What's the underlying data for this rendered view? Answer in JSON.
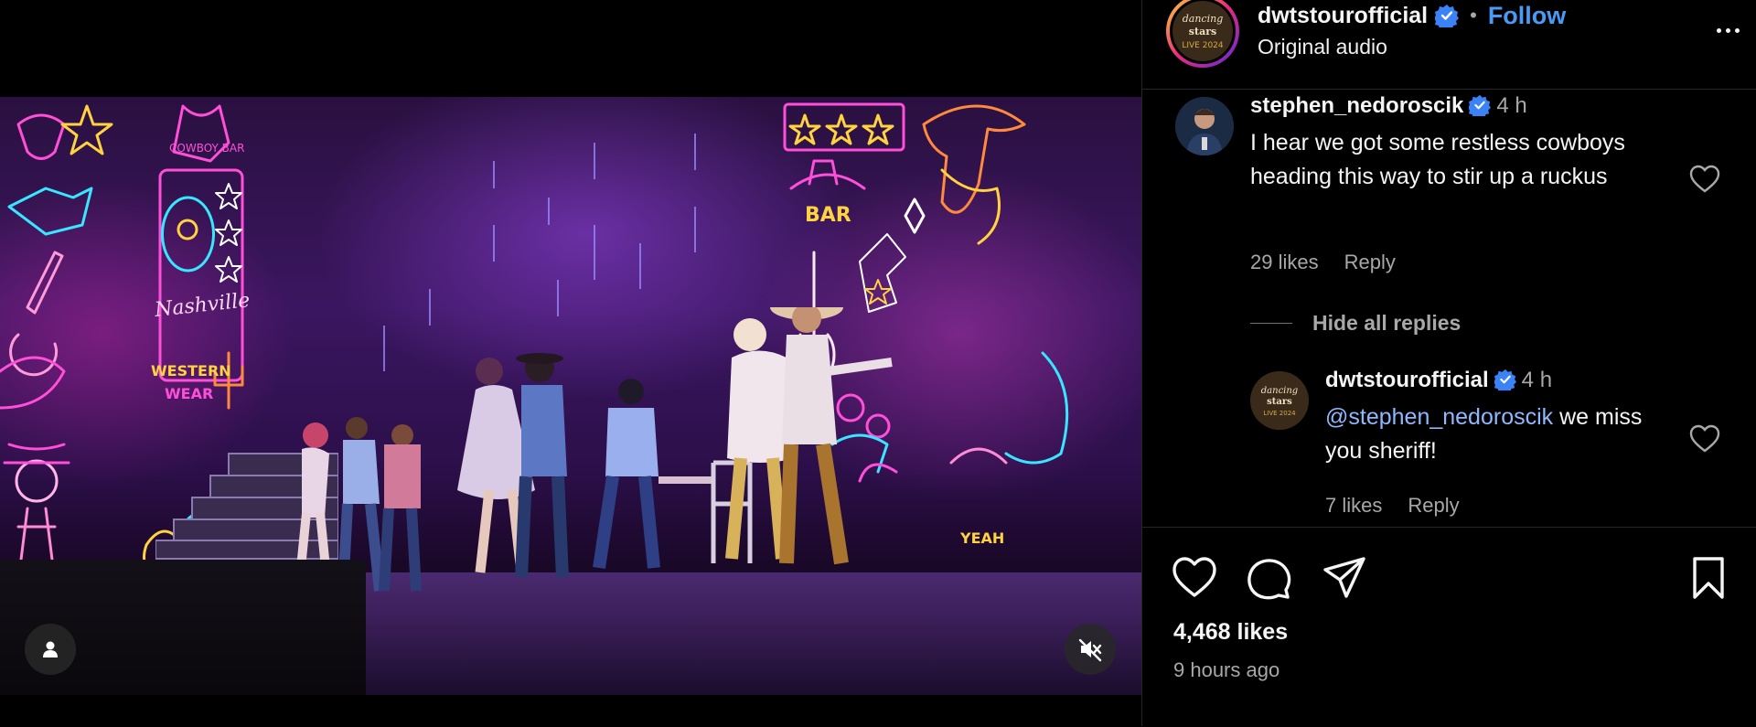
{
  "post": {
    "username": "dwtstourofficial",
    "follow_label": "Follow",
    "separator": "•",
    "audio_label": "Original audio",
    "avatar_text": [
      "dancing",
      "stars",
      "LIVE 2024"
    ]
  },
  "comments": [
    {
      "username": "stephen_nedoroscik",
      "time": "4 h",
      "text": "I hear we got some restless cowboys heading this way to stir up a ruckus",
      "likes": "29 likes",
      "reply_label": "Reply"
    }
  ],
  "hide_replies_label": "Hide all replies",
  "replies": [
    {
      "username": "dwtstourofficial",
      "time": "4 h",
      "mention": "@stephen_nedoroscik",
      "text": " we miss you sheriff!",
      "likes": "7 likes",
      "reply_label": "Reply"
    }
  ],
  "stats": {
    "likes": "4,468 likes",
    "posted": "9 hours ago"
  },
  "video": {
    "sign_texts": [
      "COWBOY BAR",
      "Nashville",
      "WESTERN WEAR",
      "BAR",
      "YEAH"
    ]
  },
  "colors": {
    "follow_blue": "#4a9af5",
    "verified_blue": "#3b82f6",
    "neon_pink": "#ff4fd8",
    "neon_cyan": "#39e6ff",
    "neon_yellow": "#ffd23f"
  },
  "icons": [
    "verified-icon",
    "more-icon",
    "heart-icon",
    "comment-icon",
    "share-icon",
    "bookmark-icon",
    "user-tag-icon",
    "muted-speaker-icon"
  ]
}
